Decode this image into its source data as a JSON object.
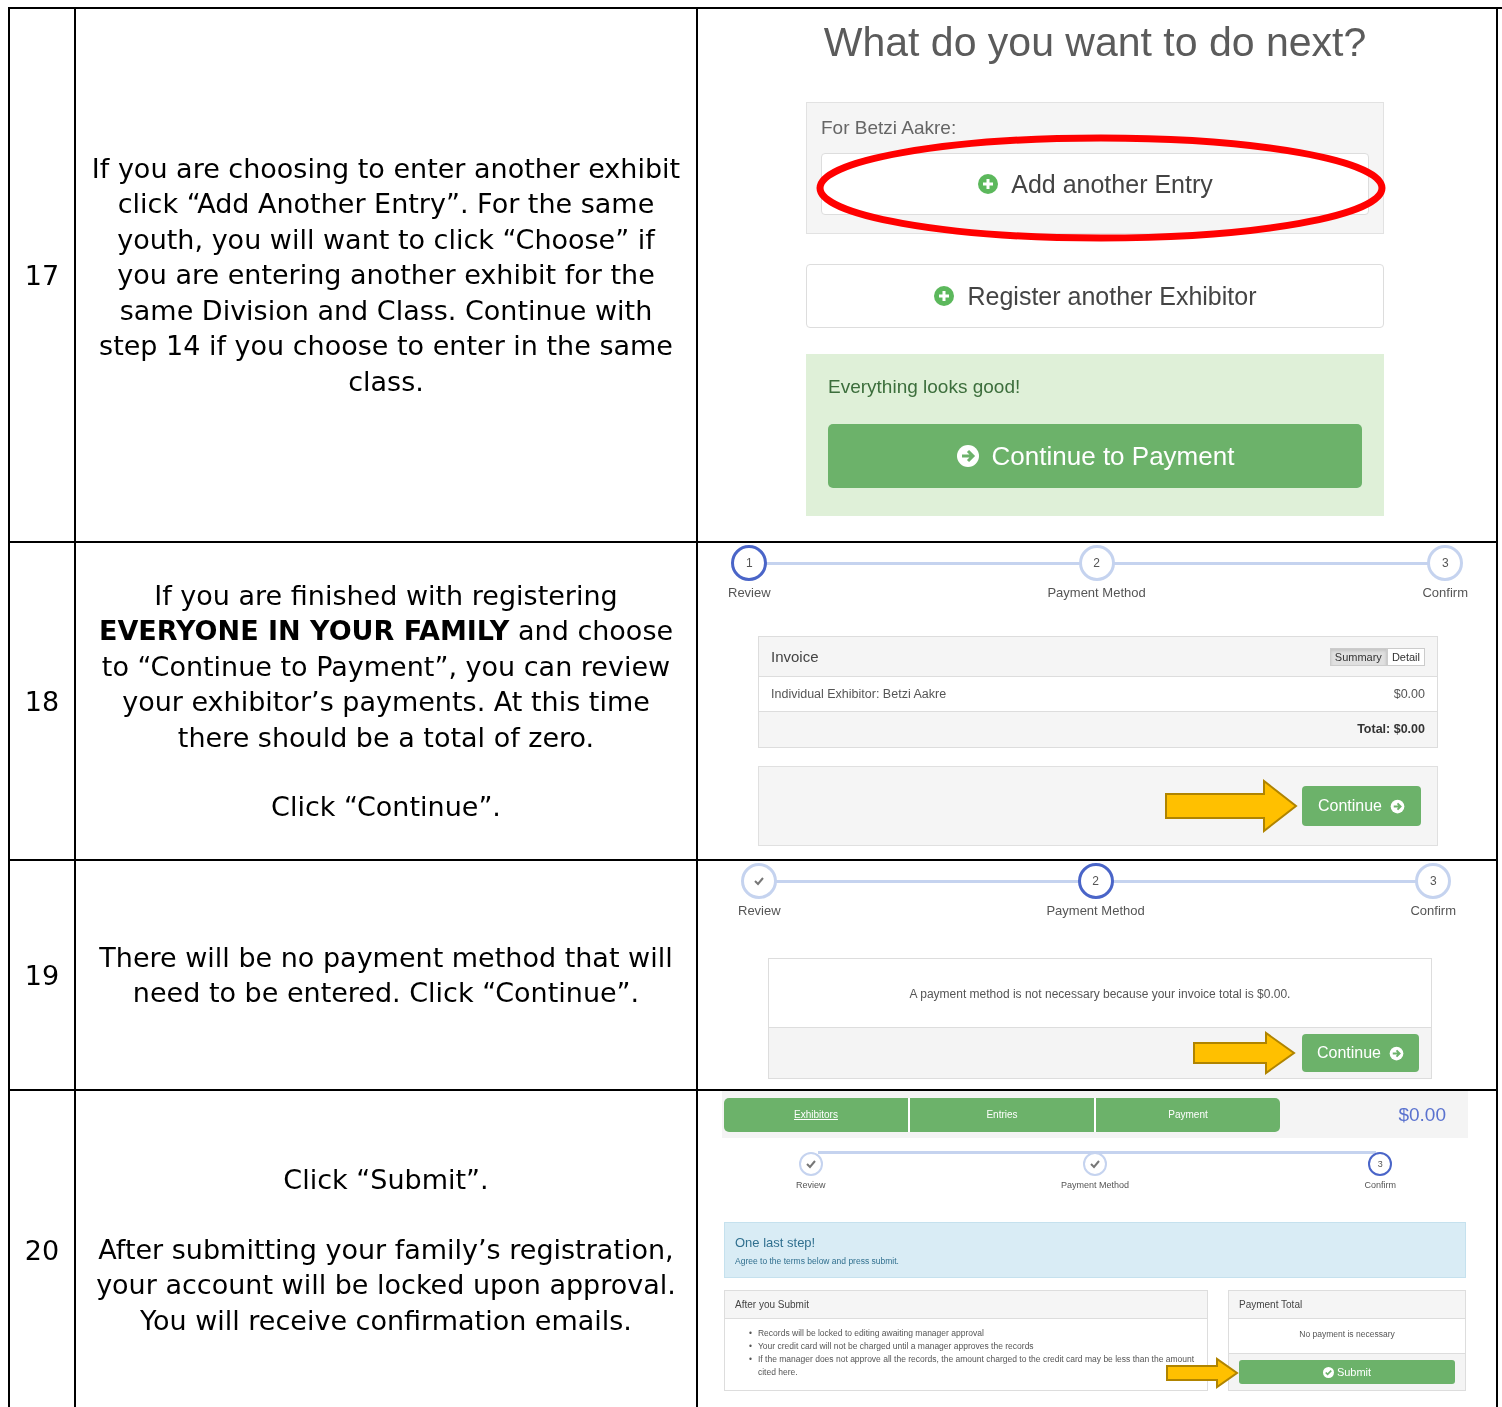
{
  "steps": [
    {
      "number": "17",
      "paragraphs": [
        "If you are choosing to enter another exhibit click “Add Another Entry”. For the same youth, you will want to click “Choose” if you are entering another exhibit for the same Division and Class. Continue with step 14 if you choose to enter in the same class."
      ],
      "screen": {
        "kind": "next",
        "title": "What do you want to do next?",
        "for_label": "For Betzi Aakre:",
        "add_button": {
          "label": "Add another Entry",
          "circled": true
        },
        "register_button": "Register another Exhibitor",
        "status": "Everything looks good!",
        "continue_button": "Continue to Payment"
      }
    },
    {
      "number": "18",
      "paragraphs": [
        "If you are finished with registering **EVERYONE IN YOUR FAMILY** and choose to “Continue to Payment”, you can review your exhibitor’s payments. At this time there should be a total of zero.",
        "Click “Continue”."
      ],
      "screen": {
        "kind": "invoice",
        "stepper": [
          {
            "number": "1",
            "label": "Review",
            "done": false,
            "current": true
          },
          {
            "number": "2",
            "label": "Payment Method",
            "done": false,
            "current": false
          },
          {
            "number": "3",
            "label": "Confirm",
            "done": false,
            "current": false
          }
        ],
        "invoice_title": "Invoice",
        "toggle": [
          {
            "label": "Summary",
            "selected": true
          },
          {
            "label": "Detail",
            "selected": false
          }
        ],
        "line": {
          "name": "Individual Exhibitor: Betzi Aakre",
          "amount": "$0.00"
        },
        "total": "Total: $0.00",
        "continue_button": {
          "label": "Continue",
          "arrow": true
        }
      }
    },
    {
      "number": "19",
      "paragraphs": [
        "There will be no payment method that will need to be entered. Click “Continue”."
      ],
      "screen": {
        "kind": "payment",
        "stepper": [
          {
            "label": "Review",
            "done": true,
            "current": false
          },
          {
            "number": "2",
            "label": "Payment Method",
            "done": false,
            "current": true
          },
          {
            "number": "3",
            "label": "Confirm",
            "done": false,
            "current": false
          }
        ],
        "message": "A payment method is not necessary because your invoice total is $0.00.",
        "continue_button": {
          "label": "Continue",
          "arrow": true
        }
      }
    },
    {
      "number": "20",
      "paragraphs": [
        "Click “Submit”.",
        "After submitting your family’s registration, your account will be locked upon approval. You will receive confirmation emails."
      ],
      "screen": {
        "kind": "confirm",
        "breadcrumbs": [
          {
            "label": "Exhibitors",
            "link": true
          },
          {
            "label": "Entries",
            "link": false
          },
          {
            "label": "Payment",
            "link": false
          }
        ],
        "cart_total": "$0.00",
        "stepper": [
          {
            "label": "Review",
            "done": true,
            "current": false
          },
          {
            "label": "Payment Method",
            "done": true,
            "current": false
          },
          {
            "number": "3",
            "label": "Confirm",
            "done": false,
            "current": true
          }
        ],
        "alert_title": "One last step!",
        "alert_text": "Agree to the terms below and press submit.",
        "after_title": "After you Submit",
        "bullet": "•",
        "after_items": [
          "Records will be locked to editing awaiting manager approval",
          "Your credit card will not be charged until a manager approves the records",
          "If the manager does not approve all the records, the amount charged to the credit card may be less than the amount cited here."
        ],
        "total_title": "Payment Total",
        "total_text": "No payment is necessary",
        "submit_button": {
          "label": "Submit",
          "arrow": true
        }
      }
    }
  ]
}
